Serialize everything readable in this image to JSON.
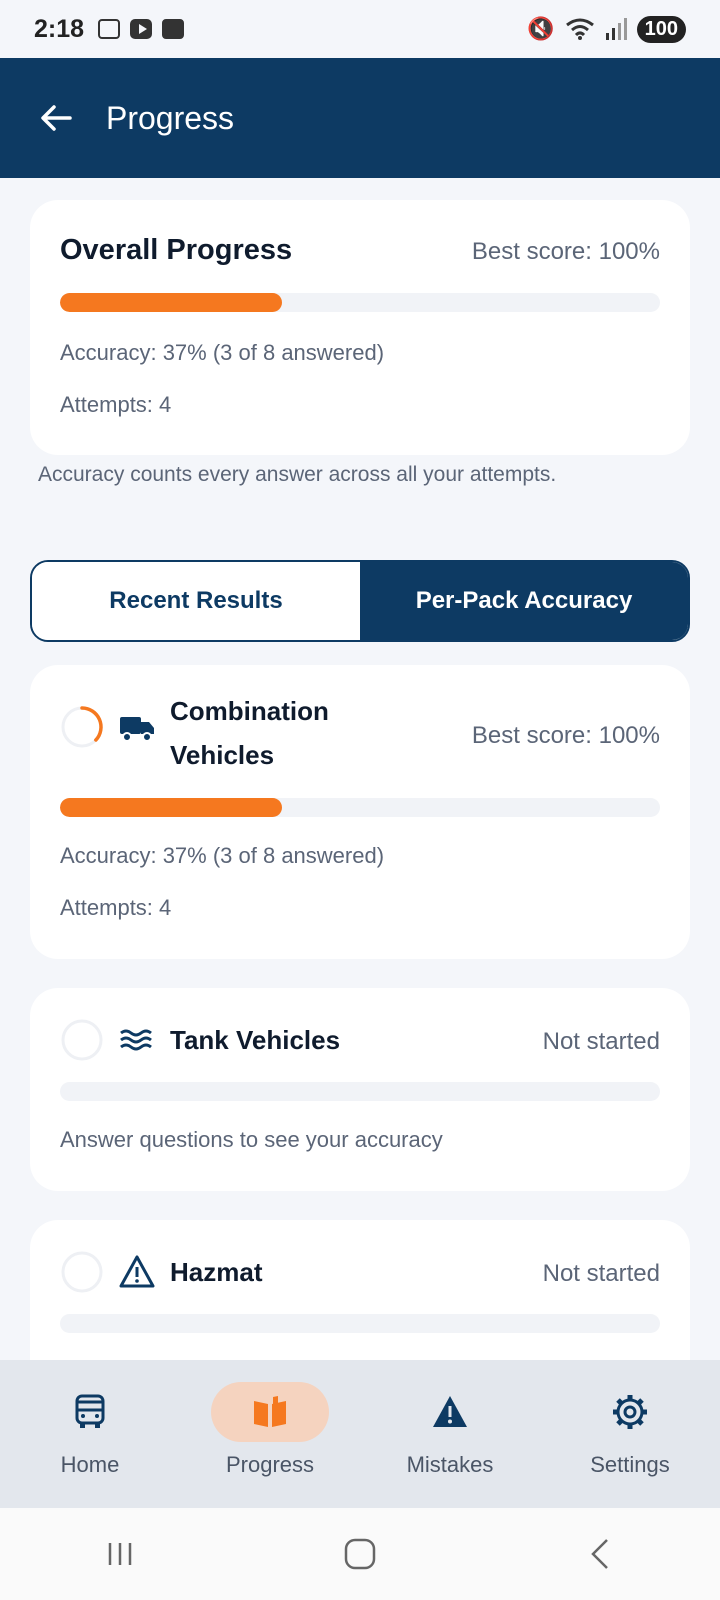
{
  "status": {
    "time": "2:18",
    "battery": "100",
    "colors": {
      "bg": "#f4f6fa"
    }
  },
  "app_bar": {
    "title": "Progress",
    "color": "#0d3a63"
  },
  "overall": {
    "title": "Overall Progress",
    "best_score": "Best score: 100%",
    "progress": 0.37,
    "accuracy": "Accuracy: 37% (3 of 8 answered)",
    "attempts": "Attempts: 4"
  },
  "note": "Accuracy counts every answer across all your attempts.",
  "tabs": [
    {
      "label": "Recent Results",
      "active": false
    },
    {
      "label": "Per-Pack Accuracy",
      "active": true
    }
  ],
  "packs": [
    {
      "name_line1": "Combination",
      "name_line2": "Vehicles",
      "icon": "truck-icon",
      "best_score": "Best score: 100%",
      "progress": 0.37,
      "accuracy": "Accuracy: 37% (3 of 8 answered)",
      "attempts": "Attempts: 4"
    },
    {
      "name": "Tank Vehicles",
      "icon": "waves-icon",
      "status": "Not started",
      "progress": 0,
      "hint": "Answer questions to see your accuracy"
    },
    {
      "name": "Hazmat",
      "icon": "warning-icon",
      "status": "Not started",
      "progress": 0
    }
  ],
  "nav": [
    {
      "label": "Home",
      "icon": "bus-icon",
      "active": false
    },
    {
      "label": "Progress",
      "icon": "book-icon",
      "active": true
    },
    {
      "label": "Mistakes",
      "icon": "warning-icon",
      "active": false
    },
    {
      "label": "Settings",
      "icon": "gear-icon",
      "active": false
    }
  ],
  "accent": "#f5781f"
}
